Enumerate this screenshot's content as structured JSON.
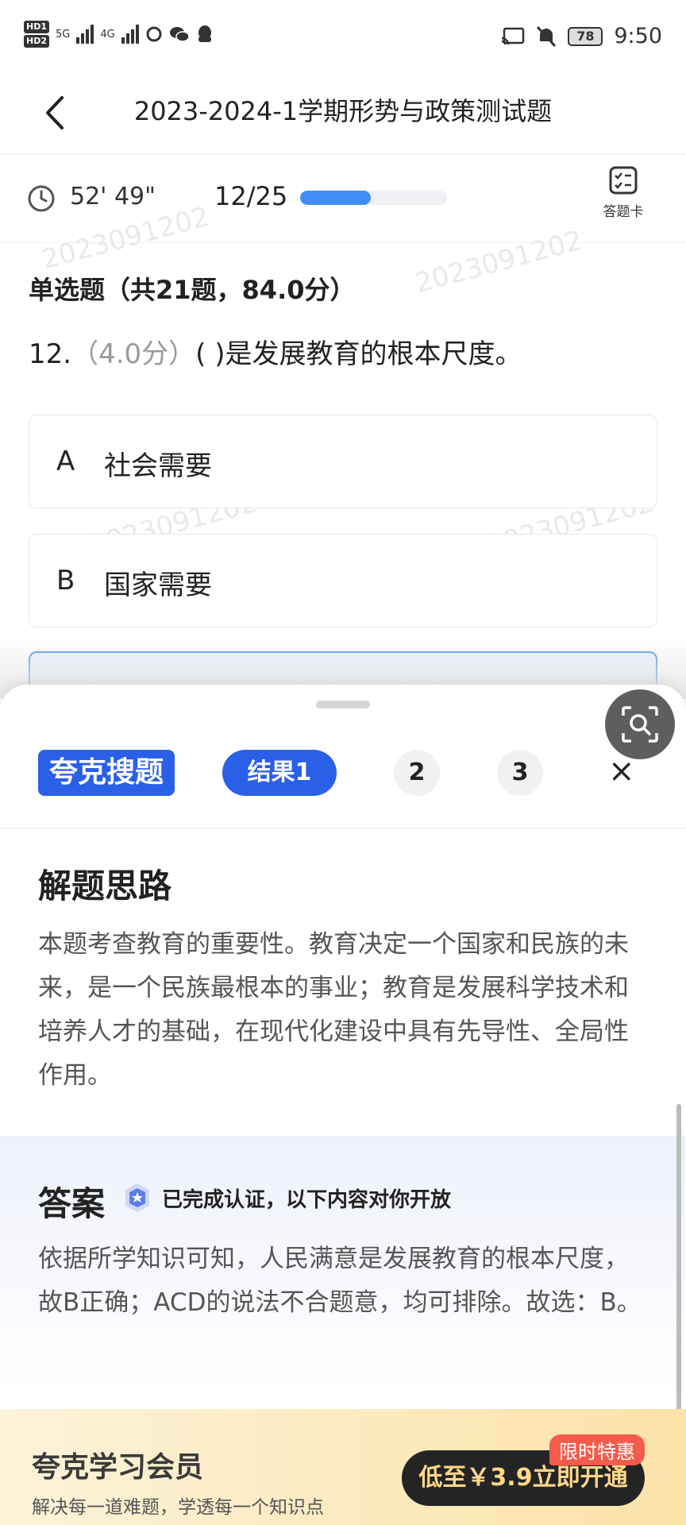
{
  "status": {
    "network1": "5G",
    "network2": "4G",
    "battery": "78",
    "time": "9:50"
  },
  "header": {
    "title": "2023-2024-1学期形势与政策测试题"
  },
  "timer": {
    "time": "52' 49\"",
    "progress_text": "12/25",
    "progress": 0.48,
    "answer_card_label": "答题卡"
  },
  "question": {
    "section": "单选题（共21题，84.0分）",
    "number": "12.",
    "score": "（4.0分）",
    "text": "( )是发展教育的根本尺度。",
    "options": [
      {
        "letter": "A",
        "text": "社会需要"
      },
      {
        "letter": "B",
        "text": "国家需要"
      }
    ]
  },
  "watermark": "2023091202",
  "search": {
    "brand": "夸克搜题",
    "tabs": [
      "结果1",
      "2",
      "3"
    ],
    "close": "×",
    "analysis_heading": "解题思路",
    "analysis_text": "本题考查教育的重要性。教育决定一个国家和民族的未来，是一个民族最根本的事业；教育是发展科学技术和培养人才的基础，在现代化建设中具有先导性、全局性作用。",
    "answer_heading": "答案",
    "answer_note": "已完成认证，以下内容对你开放",
    "answer_text": "依据所学知识可知，人民满意是发展教育的根本尺度，故B正确；ACD的说法不合题意，均可排除。故选：B。"
  },
  "promo": {
    "title": "夸克学习会员",
    "subtitle": "解决每一道难题，学透每一个知识点",
    "button": "低至￥3.9立即开通",
    "tag": "限时特惠"
  }
}
